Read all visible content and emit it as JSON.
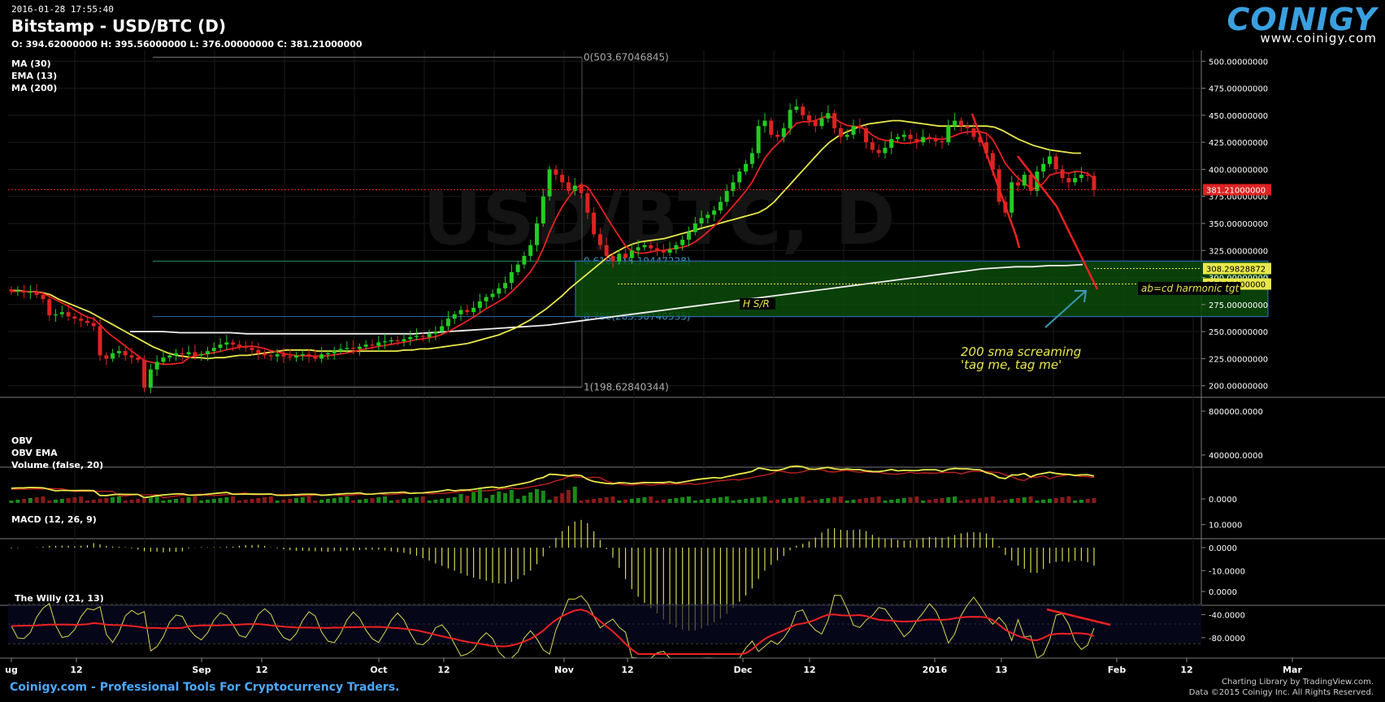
{
  "header": {
    "datetime": "2016-01-28 17:55:40",
    "title": "Bitstamp - USD/BTC (D)",
    "ohlc": "O: 394.62000000 H: 395.56000000 L: 376.00000000 C: 381.21000000",
    "watermark": "USD/BTC, D"
  },
  "logo": {
    "name": "COINIGY",
    "url": "www.coinigy.com"
  },
  "footer": {
    "left": "Coinigy.com - Professional Tools For Cryptocurrency Traders.",
    "right1": "Charting Library by TradingView.com.",
    "right2": "Data ©2015 Coinigy Inc. All Rights Reserved."
  },
  "colors": {
    "up": "#22cc22",
    "down": "#dd2222",
    "ma30": "#e8e84a",
    "ema13": "#e82020",
    "ma200": "#f0f0f0",
    "zone": "#0a4a0a",
    "accent": "#3aa0e0"
  },
  "chart_data": [
    {
      "type": "candlestick",
      "panel": "price",
      "legend": [
        "MA (30)",
        "EMA (13)",
        "MA (200)"
      ],
      "y_ticks": [
        "500.00000000",
        "475.00000000",
        "450.00000000",
        "425.00000000",
        "400.00000000",
        "375.00000000",
        "350.00000000",
        "325.00000000",
        "300.00000000",
        "275.00000000",
        "250.00000000",
        "225.00000000",
        "200.00000000"
      ],
      "ylim": [
        190,
        510
      ],
      "x_ticks": [
        "ug",
        "12",
        "Sep",
        "12",
        "Oct",
        "12",
        "Nov",
        "12",
        "Dec",
        "12",
        "2016",
        "13",
        "Feb",
        "12",
        "Mar"
      ],
      "last_price": {
        "value": 381.21,
        "label": "381.21000000"
      },
      "markers": [
        {
          "value": 308.29828872,
          "label": "308.29828872"
        },
        {
          "value": 294.0,
          "label": "294.00000000"
        }
      ],
      "fib_levels": [
        {
          "ratio": 0,
          "value": 503.67046845,
          "label": "0(503.67046845)"
        },
        {
          "ratio": 0.618,
          "value": 315.19447228,
          "label": "0.618(315.19447228)"
        },
        {
          "ratio": 0.786,
          "value": 263.90740535,
          "label": "0.786(263.90740535)"
        },
        {
          "ratio": 1,
          "value": 198.62840344,
          "label": "1(198.62840344)"
        }
      ],
      "annotations": [
        "H S/R",
        "ab=cd harmonic tgt",
        "200 sma screaming",
        "'tag me, tag me'"
      ],
      "zone": {
        "from": 263.9,
        "to": 315.2
      },
      "series": {
        "close": [
          287,
          288,
          286,
          287,
          284,
          280,
          265,
          266,
          268,
          264,
          262,
          260,
          258,
          255,
          228,
          225,
          230,
          232,
          228,
          226,
          224,
          198,
          215,
          222,
          226,
          228,
          230,
          229,
          231,
          228,
          229,
          232,
          235,
          238,
          240,
          238,
          236,
          235,
          233,
          230,
          228,
          227,
          229,
          227,
          226,
          228,
          229,
          227,
          225,
          229,
          230,
          232,
          234,
          235,
          234,
          236,
          238,
          237,
          240,
          241,
          242,
          241,
          243,
          245,
          246,
          245,
          248,
          250,
          255,
          262,
          266,
          270,
          268,
          272,
          278,
          282,
          285,
          290,
          295,
          305,
          312,
          320,
          330,
          350,
          375,
          400,
          395,
          388,
          380,
          385,
          378,
          360,
          340,
          330,
          320,
          315,
          322,
          318,
          325,
          328,
          330,
          327,
          325,
          323,
          326,
          330,
          335,
          342,
          350,
          355,
          358,
          362,
          370,
          380,
          388,
          398,
          405,
          415,
          440,
          445,
          432,
          430,
          438,
          455,
          458,
          450,
          445,
          440,
          447,
          452,
          438,
          430,
          432,
          440,
          438,
          425,
          418,
          415,
          420,
          428,
          430,
          432,
          428,
          425,
          430,
          428,
          426,
          425,
          440,
          445,
          440,
          438,
          430,
          425,
          415,
          400,
          370,
          360,
          388,
          385,
          395,
          380,
          398,
          405,
          412,
          400,
          392,
          388,
          392,
          395,
          394,
          381
        ],
        "ma30": [
          288,
          288,
          287,
          287,
          286,
          284,
          280,
          277,
          274,
          271,
          268,
          264,
          260,
          256,
          252,
          248,
          244,
          240,
          236,
          233,
          230,
          228,
          227,
          226,
          226,
          225,
          226,
          226,
          227,
          228,
          228,
          229,
          230,
          231,
          232,
          233,
          233,
          233,
          233,
          232,
          232,
          232,
          232,
          232,
          232,
          232,
          232,
          232,
          232,
          232,
          233,
          233,
          234,
          234,
          235,
          236,
          237,
          238,
          239,
          241,
          243,
          245,
          247,
          250,
          253,
          257,
          261,
          266,
          271,
          277,
          283,
          290,
          296,
          302,
          308,
          314,
          320,
          324,
          328,
          331,
          333,
          334,
          335,
          336,
          338,
          340,
          342,
          344,
          346,
          348,
          350,
          352,
          354,
          356,
          358,
          360,
          364,
          370,
          378,
          386,
          394,
          402,
          410,
          418,
          425,
          430,
          434,
          437,
          440,
          442,
          443,
          444,
          445,
          445,
          444,
          443,
          442,
          441,
          440,
          440,
          440,
          440,
          440,
          440,
          440,
          439,
          436,
          432,
          428,
          425,
          422,
          420,
          418,
          417,
          416,
          415,
          415
        ],
        "ma200": [
          250,
          250,
          250,
          249,
          249,
          249,
          249,
          248,
          248,
          248,
          248,
          248,
          248,
          248,
          248,
          248,
          248,
          248,
          249,
          250,
          251,
          252,
          253,
          254,
          255,
          256,
          258,
          260,
          262,
          264,
          266,
          268,
          270,
          272,
          274,
          276,
          278,
          280,
          282,
          284,
          286,
          288,
          290,
          292,
          294,
          296,
          298,
          300,
          302,
          304,
          306,
          308,
          309,
          310,
          310,
          311,
          311,
          312
        ]
      }
    },
    {
      "type": "line",
      "panel": "obv",
      "legend": [
        "OBV",
        "OBV EMA",
        "Volume (false, 20)"
      ],
      "y_ticks": [
        "800000.0000",
        "400000.0000",
        "0.0000"
      ],
      "ylim": [
        0,
        800000
      ]
    },
    {
      "type": "bar",
      "panel": "macd",
      "legend": [
        "MACD (12, 26, 9)"
      ],
      "y_ticks": [
        "10.0000",
        "0.0000",
        "-10.0000"
      ],
      "ylim": [
        -12,
        12
      ]
    },
    {
      "type": "line",
      "panel": "willy",
      "legend": [
        "The Willy (21, 13)"
      ],
      "y_ticks": [
        "0.0000",
        "-40.0000",
        "-80.0000"
      ],
      "ylim": [
        -100,
        0
      ]
    }
  ]
}
